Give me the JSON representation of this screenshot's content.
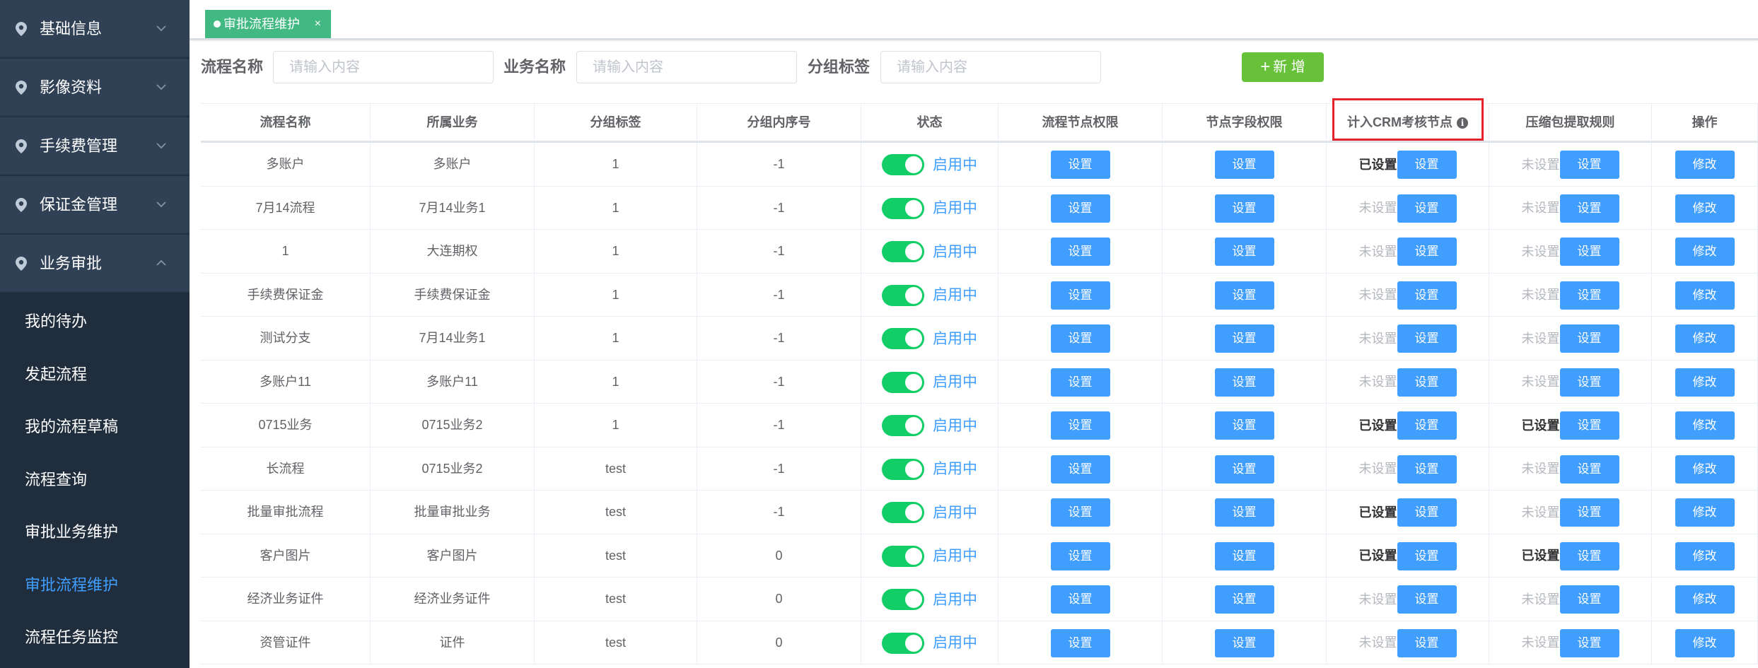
{
  "sidebar": {
    "groups": [
      {
        "label": "基础信息",
        "expanded": false
      },
      {
        "label": "影像资料",
        "expanded": false
      },
      {
        "label": "手续费管理",
        "expanded": false
      },
      {
        "label": "保证金管理",
        "expanded": false
      },
      {
        "label": "业务审批",
        "expanded": true
      }
    ],
    "sub_items": [
      {
        "label": "我的待办",
        "active": false
      },
      {
        "label": "发起流程",
        "active": false
      },
      {
        "label": "我的流程草稿",
        "active": false
      },
      {
        "label": "流程查询",
        "active": false
      },
      {
        "label": "审批业务维护",
        "active": false
      },
      {
        "label": "审批流程维护",
        "active": true
      },
      {
        "label": "流程任务监控",
        "active": false
      }
    ]
  },
  "tabs": {
    "active_label": "审批流程维护",
    "close_glyph": "×"
  },
  "filters": {
    "flow_name_label": "流程名称",
    "flow_name_placeholder": "请输入内容",
    "business_name_label": "业务名称",
    "business_name_placeholder": "请输入内容",
    "group_tag_label": "分组标签",
    "group_tag_placeholder": "请输入内容",
    "add_button_label": "新 增",
    "add_button_icon": "plus-icon"
  },
  "table": {
    "columns": [
      "流程名称",
      "所属业务",
      "分组标签",
      "分组内序号",
      "状态",
      "流程节点权限",
      "节点字段权限",
      "计入CRM考核节点",
      "压缩包提取规则",
      "操作"
    ],
    "crm_info_glyph": "i",
    "status_label": "启用中",
    "set_button_label": "设置",
    "edit_button_label": "修改",
    "set_text": "已设置",
    "unset_text": "未设置",
    "rows": [
      {
        "name": "多账户",
        "business": "多账户",
        "tag": "1",
        "seq": "-1",
        "crm": "已设置",
        "crm_set": true,
        "zip": "未设置",
        "zip_set": false
      },
      {
        "name": "7月14流程",
        "business": "7月14业务1",
        "tag": "1",
        "seq": "-1",
        "crm": "未设置",
        "crm_set": false,
        "zip": "未设置",
        "zip_set": false
      },
      {
        "name": "1",
        "business": "大连期权",
        "tag": "1",
        "seq": "-1",
        "crm": "未设置",
        "crm_set": false,
        "zip": "未设置",
        "zip_set": false
      },
      {
        "name": "手续费保证金",
        "business": "手续费保证金",
        "tag": "1",
        "seq": "-1",
        "crm": "未设置",
        "crm_set": false,
        "zip": "未设置",
        "zip_set": false
      },
      {
        "name": "测试分支",
        "business": "7月14业务1",
        "tag": "1",
        "seq": "-1",
        "crm": "未设置",
        "crm_set": false,
        "zip": "未设置",
        "zip_set": false
      },
      {
        "name": "多账户11",
        "business": "多账户11",
        "tag": "1",
        "seq": "-1",
        "crm": "未设置",
        "crm_set": false,
        "zip": "未设置",
        "zip_set": false
      },
      {
        "name": "0715业务",
        "business": "0715业务2",
        "tag": "1",
        "seq": "-1",
        "crm": "已设置",
        "crm_set": true,
        "zip": "已设置",
        "zip_set": true
      },
      {
        "name": "长流程",
        "business": "0715业务2",
        "tag": "test",
        "seq": "-1",
        "crm": "未设置",
        "crm_set": false,
        "zip": "未设置",
        "zip_set": false
      },
      {
        "name": "批量审批流程",
        "business": "批量审批业务",
        "tag": "test",
        "seq": "-1",
        "crm": "已设置",
        "crm_set": true,
        "zip": "未设置",
        "zip_set": false
      },
      {
        "name": "客户图片",
        "business": "客户图片",
        "tag": "test",
        "seq": "0",
        "crm": "已设置",
        "crm_set": true,
        "zip": "已设置",
        "zip_set": true
      },
      {
        "name": "经济业务证件",
        "business": "经济业务证件",
        "tag": "test",
        "seq": "0",
        "crm": "未设置",
        "crm_set": false,
        "zip": "未设置",
        "zip_set": false
      },
      {
        "name": "资管证件",
        "business": "证件",
        "tag": "test",
        "seq": "0",
        "crm": "未设置",
        "crm_set": false,
        "zip": "未设置",
        "zip_set": false
      }
    ]
  },
  "colors": {
    "sidebar_bg": "#1f2d3d",
    "sidebar_group_bg": "#304156",
    "active_menu": "#409eff",
    "tab_active": "#42b983",
    "add_button": "#67c23a",
    "primary_button": "#409eff",
    "switch_on": "#13ce66",
    "highlight_box": "#e6212a"
  }
}
